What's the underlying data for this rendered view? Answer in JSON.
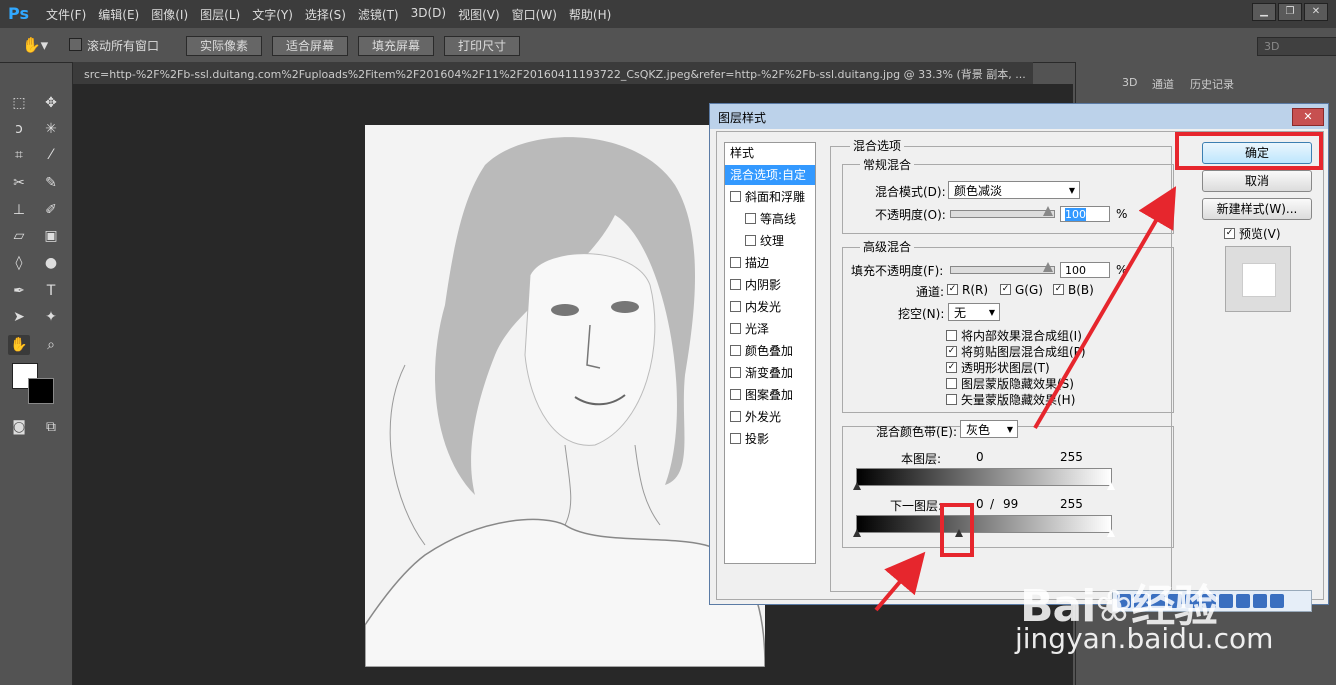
{
  "menu": {
    "logo": "Ps",
    "items": [
      "文件(F)",
      "编辑(E)",
      "图像(I)",
      "图层(L)",
      "文字(Y)",
      "选择(S)",
      "滤镜(T)",
      "3D(D)",
      "视图(V)",
      "窗口(W)",
      "帮助(H)"
    ]
  },
  "options": {
    "scroll_all_label": "滚动所有窗口",
    "buttons": [
      "实际像素",
      "适合屏幕",
      "填充屏幕",
      "打印尺寸"
    ],
    "workspace": "3D"
  },
  "document": {
    "tab_title": "src=http-%2F%2Fb-ssl.duitang.com%2Fuploads%2Fitem%2F201604%2F11%2F20160411193722_CsQKZ.jpeg&refer=http-%2F%2Fb-ssl.duitang.jpg @ 33.3% (背景 副本, ..."
  },
  "right_panel": {
    "tabs": [
      "3D",
      "通道",
      "历史记录"
    ]
  },
  "dialog": {
    "title": "图层样式",
    "close": "✕",
    "styles_header": "样式",
    "styles": [
      {
        "label": "混合选项:自定",
        "check": false,
        "selected": true,
        "indent": false
      },
      {
        "label": "斜面和浮雕",
        "check": true,
        "selected": false,
        "indent": false
      },
      {
        "label": "等高线",
        "check": true,
        "selected": false,
        "indent": true
      },
      {
        "label": "纹理",
        "check": true,
        "selected": false,
        "indent": true
      },
      {
        "label": "描边",
        "check": true,
        "selected": false,
        "indent": false
      },
      {
        "label": "内阴影",
        "check": true,
        "selected": false,
        "indent": false
      },
      {
        "label": "内发光",
        "check": true,
        "selected": false,
        "indent": false
      },
      {
        "label": "光泽",
        "check": true,
        "selected": false,
        "indent": false
      },
      {
        "label": "颜色叠加",
        "check": true,
        "selected": false,
        "indent": false
      },
      {
        "label": "渐变叠加",
        "check": true,
        "selected": false,
        "indent": false
      },
      {
        "label": "图案叠加",
        "check": true,
        "selected": false,
        "indent": false
      },
      {
        "label": "外发光",
        "check": true,
        "selected": false,
        "indent": false
      },
      {
        "label": "投影",
        "check": true,
        "selected": false,
        "indent": false
      }
    ],
    "blend_options": {
      "title": "混合选项",
      "general_title": "常规混合",
      "blend_mode_label": "混合模式(D):",
      "blend_mode_value": "颜色减淡",
      "opacity_label": "不透明度(O):",
      "opacity_value": "100",
      "opacity_unit": "%",
      "advanced_title": "高级混合",
      "fill_label": "填充不透明度(F):",
      "fill_value": "100",
      "fill_unit": "%",
      "channels_label": "通道:",
      "channel_r": "R(R)",
      "channel_g": "G(G)",
      "channel_b": "B(B)",
      "knockout_label": "挖空(N):",
      "knockout_value": "无",
      "advanced_checks": [
        {
          "label": "将内部效果混合成组(I)",
          "checked": false
        },
        {
          "label": "将剪贴图层混合成组(P)",
          "checked": true
        },
        {
          "label": "透明形状图层(T)",
          "checked": true
        },
        {
          "label": "图层蒙版隐藏效果(S)",
          "checked": false
        },
        {
          "label": "矢量蒙版隐藏效果(H)",
          "checked": false
        }
      ],
      "blend_if_label": "混合颜色带(E):",
      "blend_if_value": "灰色",
      "this_layer_label": "本图层:",
      "this_layer_low": "0",
      "this_layer_high": "255",
      "underlying_label": "下一图层:",
      "underlying_low": "0",
      "underlying_sep": "/",
      "underlying_mid": "99",
      "underlying_high": "255"
    },
    "buttons": {
      "ok": "确定",
      "cancel": "取消",
      "new_style": "新建样式(W)...",
      "preview": "预览(V)"
    }
  },
  "watermark": {
    "brand": "Bai",
    "brand_suffix": "经验",
    "url": "jingyan.baidu.com"
  },
  "colors": {
    "annotation_red": "#e6262d",
    "selection_blue": "#3399ff"
  }
}
